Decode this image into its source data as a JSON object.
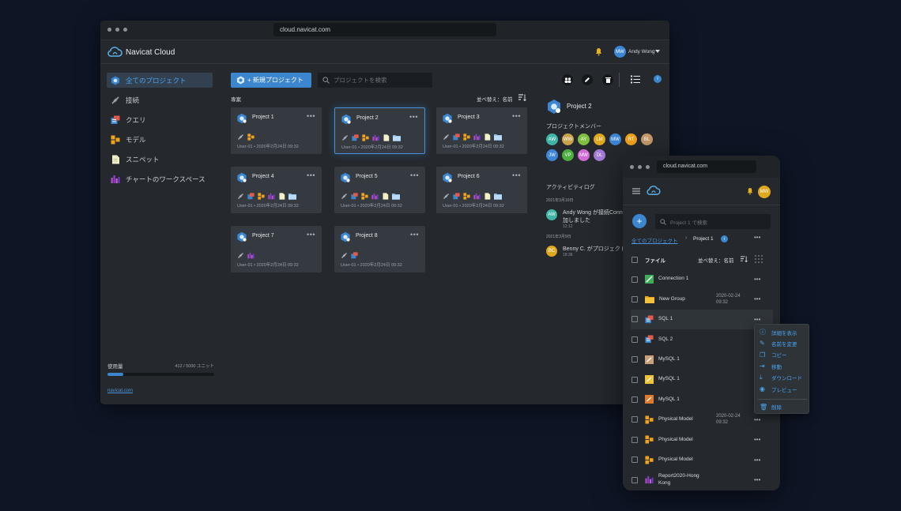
{
  "desktop": {
    "url": "cloud.navicat.com",
    "app_name": "Navicat Cloud",
    "user": {
      "initials": "MW",
      "name": "Andy Wong"
    },
    "sidebar": {
      "items": [
        {
          "label": "全てのプロジェクト",
          "icon": "projects-icon"
        },
        {
          "label": "接続",
          "icon": "connection-icon"
        },
        {
          "label": "クエリ",
          "icon": "query-icon"
        },
        {
          "label": "モデル",
          "icon": "model-icon"
        },
        {
          "label": "スニペット",
          "icon": "snippet-icon"
        },
        {
          "label": "チャートのワークスペース",
          "icon": "chart-icon"
        }
      ],
      "usage_label": "使用量",
      "usage_value": "412 / 5000 ユニット",
      "usage_fraction": 0.0824,
      "link": "navicat.com"
    },
    "toolbar": {
      "new_project": "+ 新規プロジェクト",
      "search_placeholder": "プロジェクトを検索",
      "section_label": "専案",
      "sort_label": "並べ替え：名前"
    },
    "projects": [
      {
        "name": "Project 1",
        "meta": "User-01 • 2020年2月24日 09:32"
      },
      {
        "name": "Project 2",
        "meta": "User-01 • 2020年2月24日 09:32"
      },
      {
        "name": "Project 3",
        "meta": "User-01 • 2020年2月24日 09:32"
      },
      {
        "name": "Project 4",
        "meta": "User-01 • 2020年2月24日 09:32"
      },
      {
        "name": "Project 5",
        "meta": "User-01 • 2020年2月24日 09:32"
      },
      {
        "name": "Project 6",
        "meta": "User-01 • 2020年2月24日 09:32"
      },
      {
        "name": "Project 7",
        "meta": "User-01 • 2020年2月24日 09:32"
      },
      {
        "name": "Project 8",
        "meta": "User-01 • 2020年2月24日 09:32"
      }
    ],
    "details": {
      "project_name": "Project 2",
      "members_label": "プロジェクトメンバー",
      "members": [
        {
          "initials": "AW",
          "color": "#3fb5a5"
        },
        {
          "initials": "WW",
          "color": "#c9a24a"
        },
        {
          "initials": "AY",
          "color": "#7fbf3f"
        },
        {
          "initials": "LM",
          "color": "#e0a81c"
        },
        {
          "initials": "MW",
          "color": "#3d86d6"
        },
        {
          "initials": "RT",
          "color": "#f0a21a"
        },
        {
          "initials": "BL",
          "color": "#c79a6a"
        },
        {
          "initials": "JW",
          "color": "#3d86d6"
        },
        {
          "initials": "VP",
          "color": "#4caf3f"
        },
        {
          "initials": "MW",
          "color": "#d26bd6"
        },
        {
          "initials": "DL",
          "color": "#a57ad8"
        }
      ],
      "activity_label": "アクティビティログ",
      "activity": [
        {
          "date": "2021年3月10日",
          "initials": "AW",
          "color": "#3fb5a5",
          "text1": "Andy Wong が接続Conn",
          "text2": "加しました",
          "time": "12:12"
        },
        {
          "date": "2021年3月9日",
          "initials": "BC",
          "color": "#e0a81c",
          "text1": "Benny C. がプロジェクト",
          "text2": "",
          "time": "18:36"
        }
      ]
    }
  },
  "mobile": {
    "url": "cloud.navicat.com",
    "user_initials": "MW",
    "search_placeholder": "Project 1 で検索",
    "breadcrumb": {
      "root": "全てのプロジェクト",
      "current": "Project 1"
    },
    "column_label": "ファイル",
    "sort_label": "並べ替え：名前",
    "files": [
      {
        "name": "Connection 1",
        "date": "",
        "icon": "connection-icon"
      },
      {
        "name": "New Group",
        "date": "2020-02-24 09:32",
        "icon": "folder-icon"
      },
      {
        "name": "SQL 1",
        "date": "",
        "icon": "sql-icon"
      },
      {
        "name": "SQL 2",
        "date": "",
        "icon": "sql-icon"
      },
      {
        "name": "MySQL 1",
        "date": "",
        "icon": "mysql-icon"
      },
      {
        "name": "MySQL 1",
        "date": "",
        "icon": "mysql-icon"
      },
      {
        "name": "MySQL 1",
        "date": "",
        "icon": "mysql-icon"
      },
      {
        "name": "Physical Model",
        "date": "2020-02-24 09:32",
        "icon": "model-icon"
      },
      {
        "name": "Physical Model",
        "date": "",
        "icon": "model-icon"
      },
      {
        "name": "Physical Model",
        "date": "",
        "icon": "model-icon"
      },
      {
        "name": "Report2020-Hong Kong",
        "date": "",
        "icon": "report-icon"
      }
    ],
    "context_menu": [
      "詳細を表示",
      "名前を変更",
      "コピー",
      "移動",
      "ダウンロード",
      "プレビュー",
      "削除"
    ]
  }
}
